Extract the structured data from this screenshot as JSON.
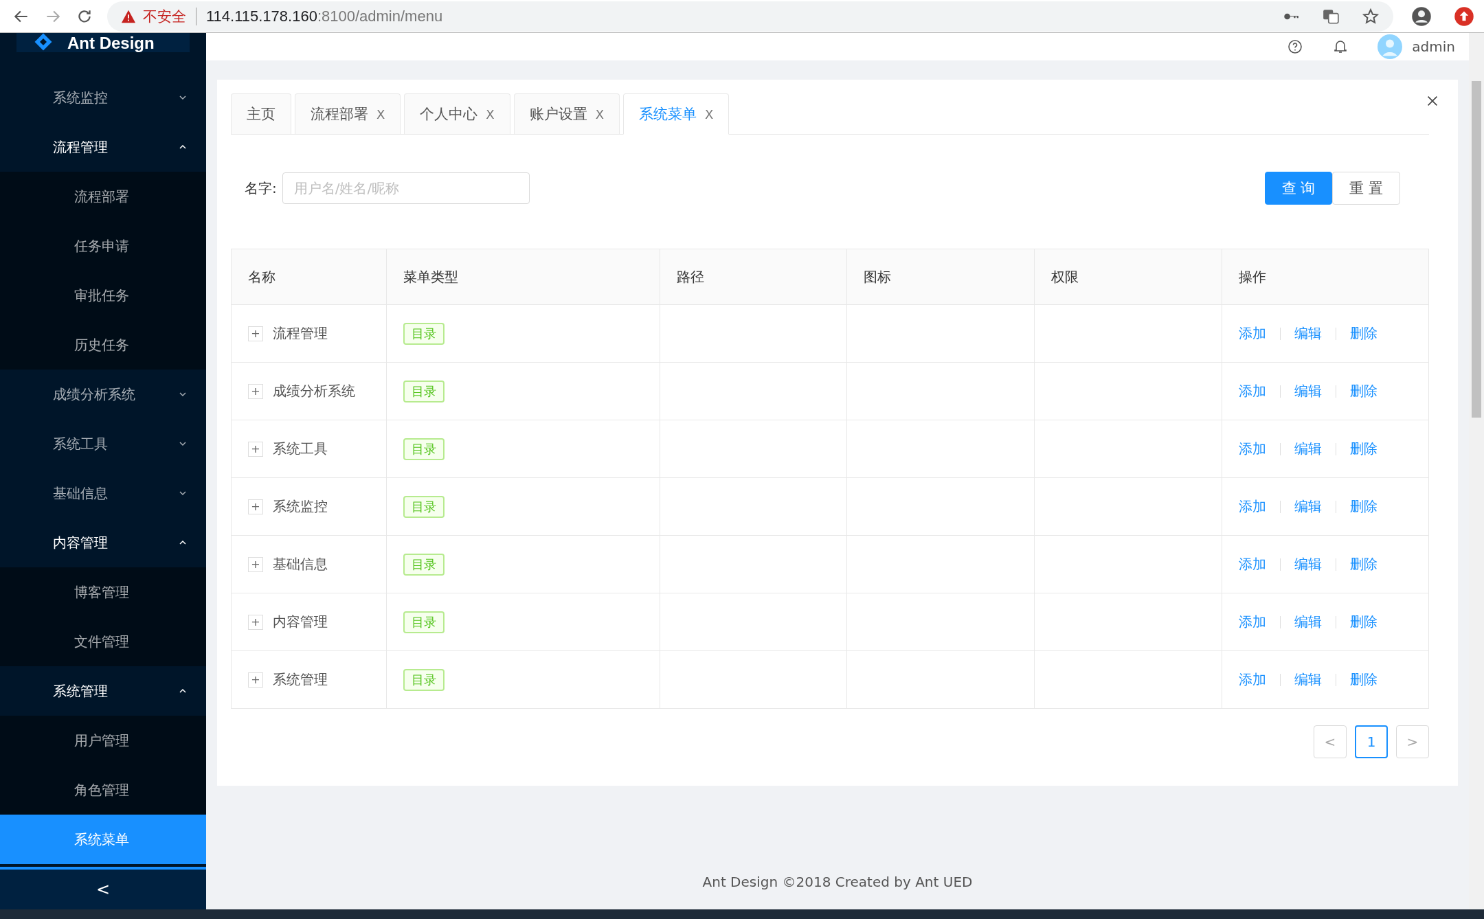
{
  "browser": {
    "security": "不安全",
    "url_host": "114.115.178.160",
    "url_path": ":8100/admin/menu"
  },
  "sidebar": {
    "logo": "Ant Design",
    "items": [
      {
        "label": "系统监控",
        "expanded": false,
        "selected": false
      },
      {
        "label": "流程管理",
        "expanded": true,
        "selected": false,
        "children": [
          {
            "label": "流程部署",
            "selected": false
          },
          {
            "label": "任务申请",
            "selected": false
          },
          {
            "label": "审批任务",
            "selected": false
          },
          {
            "label": "历史任务",
            "selected": false
          }
        ]
      },
      {
        "label": "成绩分析系统",
        "expanded": false,
        "selected": false
      },
      {
        "label": "系统工具",
        "expanded": false,
        "selected": false
      },
      {
        "label": "基础信息",
        "expanded": false,
        "selected": false
      },
      {
        "label": "内容管理",
        "expanded": true,
        "selected": false,
        "children": [
          {
            "label": "博客管理",
            "selected": false
          },
          {
            "label": "文件管理",
            "selected": false
          }
        ]
      },
      {
        "label": "系统管理",
        "expanded": true,
        "selected": false,
        "children": [
          {
            "label": "用户管理",
            "selected": false
          },
          {
            "label": "角色管理",
            "selected": false
          },
          {
            "label": "系统菜单",
            "selected": true
          }
        ]
      }
    ],
    "collapse": "<"
  },
  "header": {
    "user": "admin"
  },
  "tabs": [
    {
      "label": "主页",
      "selected": false
    },
    {
      "label": "流程部署",
      "close": "X",
      "selected": false
    },
    {
      "label": "个人中心",
      "close": "X",
      "selected": false
    },
    {
      "label": "账户设置",
      "close": "X",
      "selected": false
    },
    {
      "label": "系统菜单",
      "close": "X",
      "selected": true
    }
  ],
  "search": {
    "label": "名字:",
    "placeholder": "用户名/姓名/昵称",
    "buttons": [
      {
        "label": "查 询",
        "kind": "primary"
      },
      {
        "label": "重 置",
        "kind": "default"
      }
    ]
  },
  "table": {
    "columns": [
      "名称",
      "菜单类型",
      "路径",
      "图标",
      "权限",
      "操作"
    ],
    "rows": [
      {
        "expand": "+",
        "name": "流程管理",
        "type": "目录",
        "actions": [
          "添加",
          "编辑",
          "删除"
        ]
      },
      {
        "expand": "+",
        "name": "成绩分析系统",
        "type": "目录",
        "actions": [
          "添加",
          "编辑",
          "删除"
        ]
      },
      {
        "expand": "+",
        "name": "系统工具",
        "type": "目录",
        "actions": [
          "添加",
          "编辑",
          "删除"
        ]
      },
      {
        "expand": "+",
        "name": "系统监控",
        "type": "目录",
        "actions": [
          "添加",
          "编辑",
          "删除"
        ]
      },
      {
        "expand": "+",
        "name": "基础信息",
        "type": "目录",
        "actions": [
          "添加",
          "编辑",
          "删除"
        ]
      },
      {
        "expand": "+",
        "name": "内容管理",
        "type": "目录",
        "actions": [
          "添加",
          "编辑",
          "删除"
        ]
      },
      {
        "expand": "+",
        "name": "系统管理",
        "type": "目录",
        "actions": [
          "添加",
          "编辑",
          "删除"
        ]
      }
    ]
  },
  "pagination": {
    "prev": "<",
    "pages": [
      {
        "label": "1",
        "selected": true
      }
    ],
    "next": ">"
  },
  "footer": "Ant Design ©2018 Created by Ant UED"
}
